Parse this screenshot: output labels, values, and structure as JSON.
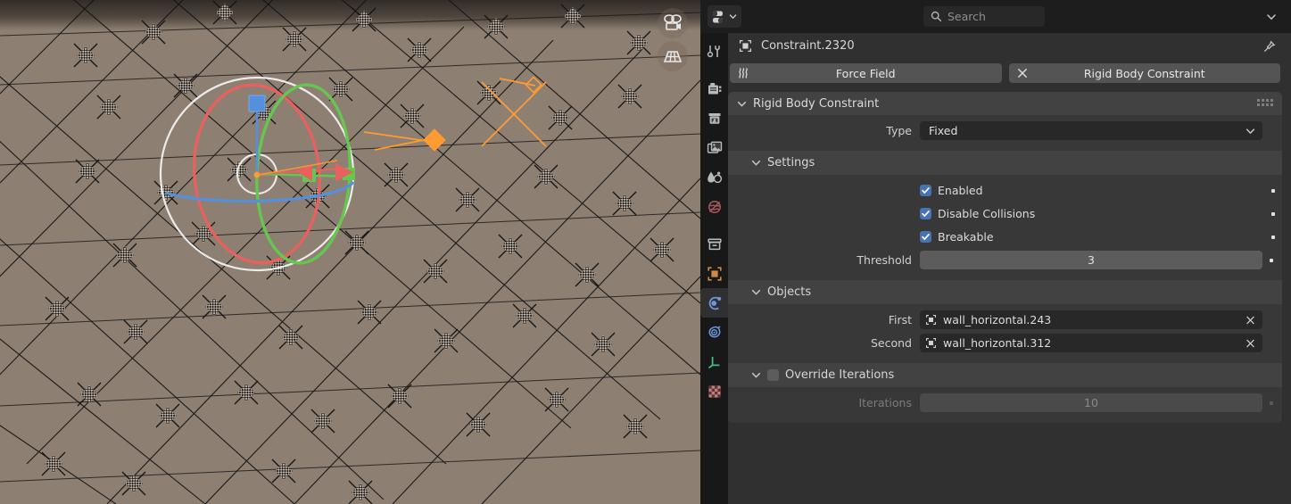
{
  "viewport": {
    "name": "3d-viewport",
    "gizmos": [
      {
        "name": "camera-view-icon",
        "label": "Camera View"
      },
      {
        "name": "grid-overlay-icon",
        "label": "Toggle Grid Overlay"
      }
    ]
  },
  "properties": {
    "editor_type": {
      "label": "Properties",
      "icon": "properties-editor-icon"
    },
    "search": {
      "placeholder": "Search",
      "value": ""
    },
    "header_collapse_label": "Expand Header",
    "breadcrumb": {
      "object_icon": "empty-object-icon",
      "text": "Constraint.2320"
    },
    "pin_label": "Pin ID Data",
    "tabs": [
      {
        "name": "tool",
        "label": "Tool",
        "icon": "tool-icon",
        "active": false
      },
      {
        "name": "render",
        "label": "Render",
        "icon": "render-camera-icon",
        "active": false
      },
      {
        "name": "output",
        "label": "Output",
        "icon": "printer-icon",
        "active": false
      },
      {
        "name": "view-layer",
        "label": "View Layer",
        "icon": "images-icon",
        "active": false
      },
      {
        "name": "scene",
        "label": "Scene",
        "icon": "scene-cone-droplet-icon",
        "active": false
      },
      {
        "name": "world",
        "label": "World",
        "icon": "world-globe-icon",
        "active": false
      },
      {
        "name": "collection",
        "label": "Collection",
        "icon": "collection-box-icon",
        "active": false
      },
      {
        "name": "object",
        "label": "Object",
        "icon": "object-square-icon",
        "active": false
      },
      {
        "name": "physics",
        "label": "Physics",
        "icon": "physics-orbit-icon",
        "active": true
      },
      {
        "name": "constraints",
        "label": "Object Constraints",
        "icon": "constraint-icon",
        "active": false
      },
      {
        "name": "object-data",
        "label": "Object Data",
        "icon": "empty-axes-icon",
        "active": false
      },
      {
        "name": "texture",
        "label": "Texture",
        "icon": "texture-checker-icon",
        "active": false
      }
    ],
    "physics_buttons": [
      {
        "name": "force-field-button",
        "label": "Force Field",
        "icon": "force-field-waves-icon"
      },
      {
        "name": "rigid-body-constraint-button",
        "label": "Rigid Body Constraint",
        "icon": "x-cross-icon"
      }
    ],
    "panel": {
      "title": "Rigid Body Constraint",
      "expanded": true,
      "type_row": {
        "label": "Type",
        "value": "Fixed"
      },
      "settings": {
        "title": "Settings",
        "expanded": true,
        "checkboxes": [
          {
            "label": "Enabled",
            "checked": true
          },
          {
            "label": "Disable Collisions",
            "checked": true
          },
          {
            "label": "Breakable",
            "checked": true
          }
        ],
        "threshold": {
          "label": "Threshold",
          "value": "3"
        }
      },
      "objects": {
        "title": "Objects",
        "expanded": true,
        "rows": [
          {
            "label": "First",
            "value": "wall_horizontal.243",
            "icon": "empty-object-icon"
          },
          {
            "label": "Second",
            "value": "wall_horizontal.312",
            "icon": "empty-object-icon"
          }
        ]
      },
      "override_iterations": {
        "title": "Override Iterations",
        "checked": false,
        "expanded": true,
        "iterations": {
          "label": "Iterations",
          "value": "10",
          "disabled": true
        }
      }
    }
  },
  "colors": {
    "accent_blue": "#4772b3",
    "panel_bg": "#424242",
    "body_bg": "#383838",
    "editor_bg": "#303030",
    "field_bg": "#282828",
    "slider_bg": "#5c5c5c",
    "button_bg": "#545454",
    "gizmo_x": "#e05a5a",
    "gizmo_y": "#5fc04f",
    "gizmo_z": "#4e8fe0",
    "selected_orange": "#ff9b33"
  }
}
